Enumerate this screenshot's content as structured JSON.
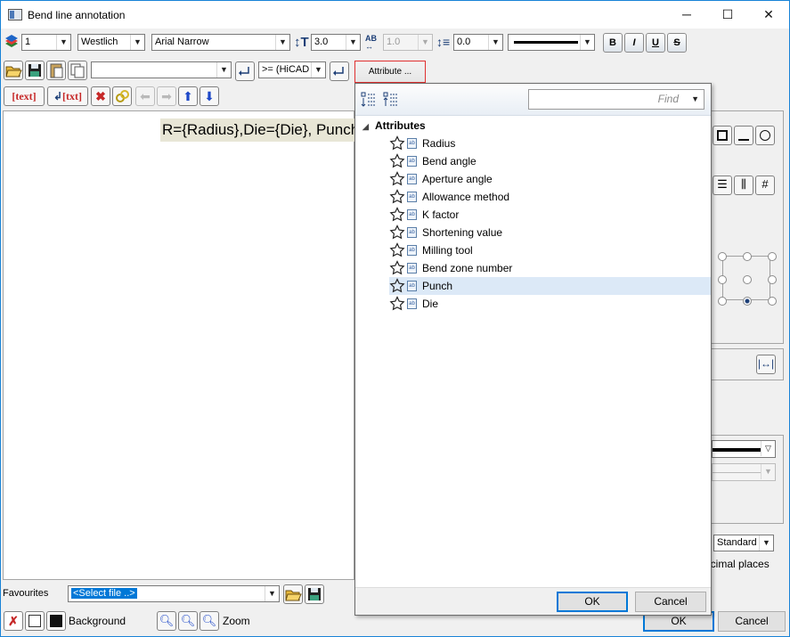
{
  "window": {
    "title": "Bend line annotation",
    "minimize": "─",
    "maximize": "☐",
    "close": "✕"
  },
  "toolbar1": {
    "layer_value": "1",
    "color_value": "Westlich",
    "font_value": "Arial Narrow",
    "height_value": "3.0",
    "width_ratio_value": "1.0",
    "line_spacing_value": "0.0",
    "bold": "B",
    "italic": "I",
    "underline": "U",
    "strike": "S"
  },
  "toolbar2": {
    "text_combo_value": "",
    "condition_value": ">= (HiCAD",
    "attribute_tab": "Attribute ..."
  },
  "toolbar3": {
    "text_btn": "text",
    "txt_btn": "txt"
  },
  "editor": {
    "content": "R={Radius},Die={Die}, Punch="
  },
  "attribute_popup": {
    "find_placeholder": "Find",
    "root_label": "Attributes",
    "items": [
      {
        "label": "Radius"
      },
      {
        "label": "Bend angle"
      },
      {
        "label": "Aperture angle"
      },
      {
        "label": "Allowance method"
      },
      {
        "label": "K factor"
      },
      {
        "label": "Shortening value"
      },
      {
        "label": "Milling tool"
      },
      {
        "label": "Bend zone number"
      },
      {
        "label": "Punch",
        "selected": true
      },
      {
        "label": "Die"
      }
    ],
    "ok": "OK",
    "cancel": "Cancel"
  },
  "right_panel": {
    "standard_value": "Standard",
    "decimal_label": "ecimal places"
  },
  "bottom": {
    "favourites_label": "Favourites",
    "select_file_value": "<Select file ..>",
    "background_label": "Background",
    "zoom_label": "Zoom",
    "ok": "OK",
    "cancel": "Cancel"
  },
  "colors": {
    "accent": "#0078d7",
    "selection": "#dce9f7",
    "editor_highlight": "#e8e6d6"
  }
}
